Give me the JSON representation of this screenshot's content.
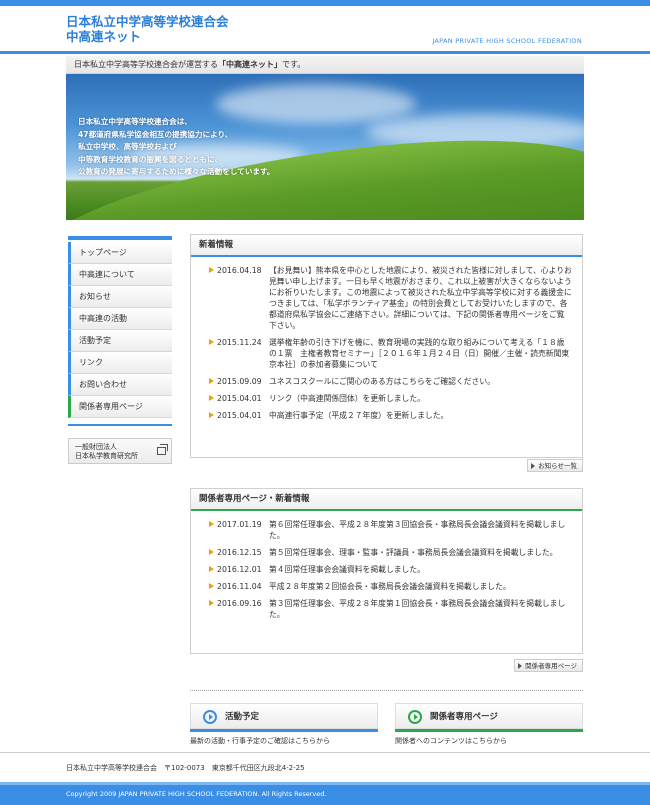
{
  "header": {
    "logo_line1": "日本私立中学高等学校連合会",
    "logo_line2": "中高連ネット",
    "en_title": "JAPAN PRIVATE HIGH SCHOOL FEDERATION"
  },
  "tagline": {
    "prefix": "日本私立中学高等学校連合会が運営する",
    "highlight": "「中高連ネット」",
    "suffix": "です。"
  },
  "hero": {
    "lines": [
      "日本私立中学高等学校連合会は、",
      "47都道府県私学協会相互の提携協力により、",
      "私立中学校、高等学校および",
      "中等教育学校教育の振興を図るとともに、",
      "公教育の発展に寄与するために様々な活動をしています。"
    ]
  },
  "sidebar": {
    "items": [
      {
        "label": "トップページ"
      },
      {
        "label": "中高連について"
      },
      {
        "label": "お知らせ"
      },
      {
        "label": "中高連の活動"
      },
      {
        "label": "活動予定"
      },
      {
        "label": "リンク"
      },
      {
        "label": "お問い合わせ"
      },
      {
        "label": "関係者専用ページ"
      }
    ],
    "banner_line1": "一般財団法人",
    "banner_line2": "日本私学教育研究所"
  },
  "news": {
    "title": "新着情報",
    "items": [
      {
        "date": "2016.04.18",
        "text": "【お見舞い】熊本県を中心とした地震により、被災された皆様に対しまして、心よりお見舞い申し上げます。一日も早く地震がおさまり、これ以上被害が大きくならないようにお祈りいたします。この地震によって被災された私立中学高等学校に対する義援金につきましては、「私学ボランティア基金」の特別会費としてお受けいたしますので、各都道府県私学協会にご連絡下さい。詳細については、下記の関係者専用ページをご覧下さい。"
      },
      {
        "date": "2015.11.24",
        "text": "選挙権年齢の引き下げを機に、教育現場の実践的な取り組みについて考える「１８歳の１票　主権者教育セミナー」［２０１６年１月２４日（日）開催／主催・読売新聞東京本社］の参加者募集について"
      },
      {
        "date": "2015.09.09",
        "text": "ユネスコスクールにご関心のある方はこちらをご確認ください。"
      },
      {
        "date": "2015.04.01",
        "text": "リンク（中高連関係団体）を更新しました。"
      },
      {
        "date": "2015.04.01",
        "text": "中高連行事予定（平成２７年度）を更新しました。"
      }
    ],
    "more_label": "お知らせ一覧"
  },
  "members": {
    "title": "関係者専用ページ・新着情報",
    "items": [
      {
        "date": "2017.01.19",
        "text": "第６回常任理事会、平成２８年度第３回協会長・事務局長会議会議資料を掲載しました。"
      },
      {
        "date": "2016.12.15",
        "text": "第５回常任理事会、理事・監事・評議員・事務局長会議会議資料を掲載しました。"
      },
      {
        "date": "2016.12.01",
        "text": "第４回常任理事会会議資料を掲載しました。"
      },
      {
        "date": "2016.11.04",
        "text": "平成２８年度第２回協会長・事務局長会議会議資料を掲載しました。"
      },
      {
        "date": "2016.09.16",
        "text": "第３回常任理事会、平成２８年度第１回協会長・事務局長会議会議資料を掲載しました。"
      }
    ],
    "more_label": "関係者専用ページ"
  },
  "cards": {
    "schedule": {
      "title": "活動予定",
      "desc": "最新の活動・行事予定のご確認はこちらから"
    },
    "members": {
      "title": "関係者専用ページ",
      "desc": "関係者へのコンテンツはこちらから"
    }
  },
  "footer": {
    "address": "日本私立中学高等学校連合会　〒102-0073　東京都千代田区九段北4-2-25",
    "copyright": "Copyright 2009 JAPAN PRIVATE HIGH SCHOOL FEDERATION. All Rights Reserved."
  },
  "colors": {
    "accent_blue": "#3a8ee6",
    "accent_green": "#2aa84a",
    "bullet_orange": "#f0a000"
  }
}
